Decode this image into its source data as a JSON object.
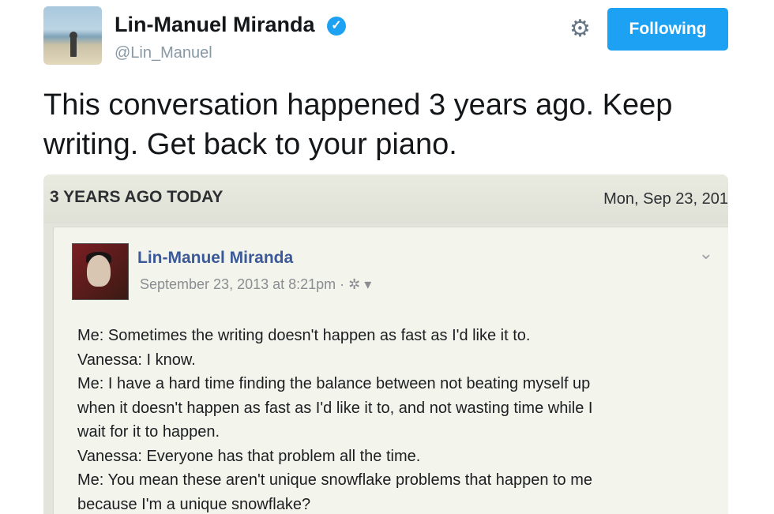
{
  "header": {
    "name": "Lin-Manuel Miranda",
    "handle": "@Lin_Manuel",
    "follow_label": "Following"
  },
  "tweet": {
    "text_line1": "This conversation happened 3 years ago. Keep",
    "text_line2": "writing. Get back to your piano."
  },
  "photo": {
    "memory_title": "3 YEARS AGO TODAY",
    "memory_date": "Mon, Sep 23, 201",
    "post": {
      "author": "Lin-Manuel Miranda",
      "timestamp": "September 23, 2013 at 8:21pm · ✲ ▾",
      "lines": [
        "Me: Sometimes the writing doesn't happen as fast as I'd like it to.",
        "Vanessa: I know.",
        "Me: I have a hard time finding the balance between not beating myself up",
        "when it doesn't happen as fast as I'd like it to, and not wasting time while I",
        "wait for it to happen.",
        "Vanessa: Everyone has that problem all the time.",
        "Me: You mean these aren't unique snowflake problems that happen to me",
        "because I'm a unique snowflake?"
      ]
    }
  },
  "icons": {
    "verified": "verified-badge-icon",
    "settings": "gear-icon",
    "menu": "chevron-down-icon"
  },
  "colors": {
    "accent": "#1da1f2",
    "facebook_link": "#3b5998"
  }
}
